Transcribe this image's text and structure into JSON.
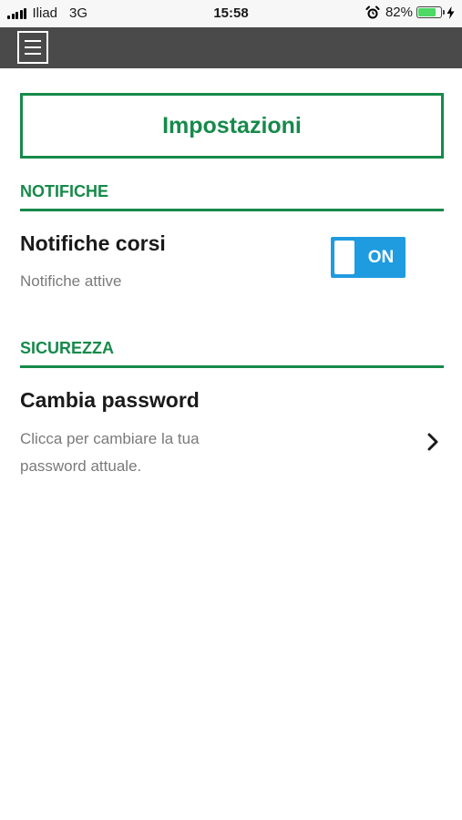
{
  "status_bar": {
    "carrier": "Iliad",
    "network": "3G",
    "time": "15:58",
    "battery_percent": "82%",
    "battery_level": 0.82,
    "icons": [
      "signal-icon",
      "alarm-icon",
      "battery-icon",
      "charging-icon"
    ]
  },
  "nav": {
    "menu_icon": "hamburger-menu-icon"
  },
  "page": {
    "title": "Impostazioni"
  },
  "sections": {
    "notifications": {
      "header": "NOTIFICHE",
      "item_title": "Notifiche corsi",
      "item_subtitle": "Notifiche attive",
      "toggle_label": "ON",
      "toggle_on": true
    },
    "security": {
      "header": "SICUREZZA",
      "item_title": "Cambia password",
      "item_subtitle_line1": "Clicca per cambiare la tua",
      "item_subtitle_line2": "password attuale.",
      "chevron_icon": "chevron-right-icon"
    }
  },
  "colors": {
    "accent_green": "#168a4a",
    "toggle_blue": "#1f9be0",
    "nav_bg": "#4a4a4a",
    "subtitle_gray": "#7a7a7a"
  }
}
